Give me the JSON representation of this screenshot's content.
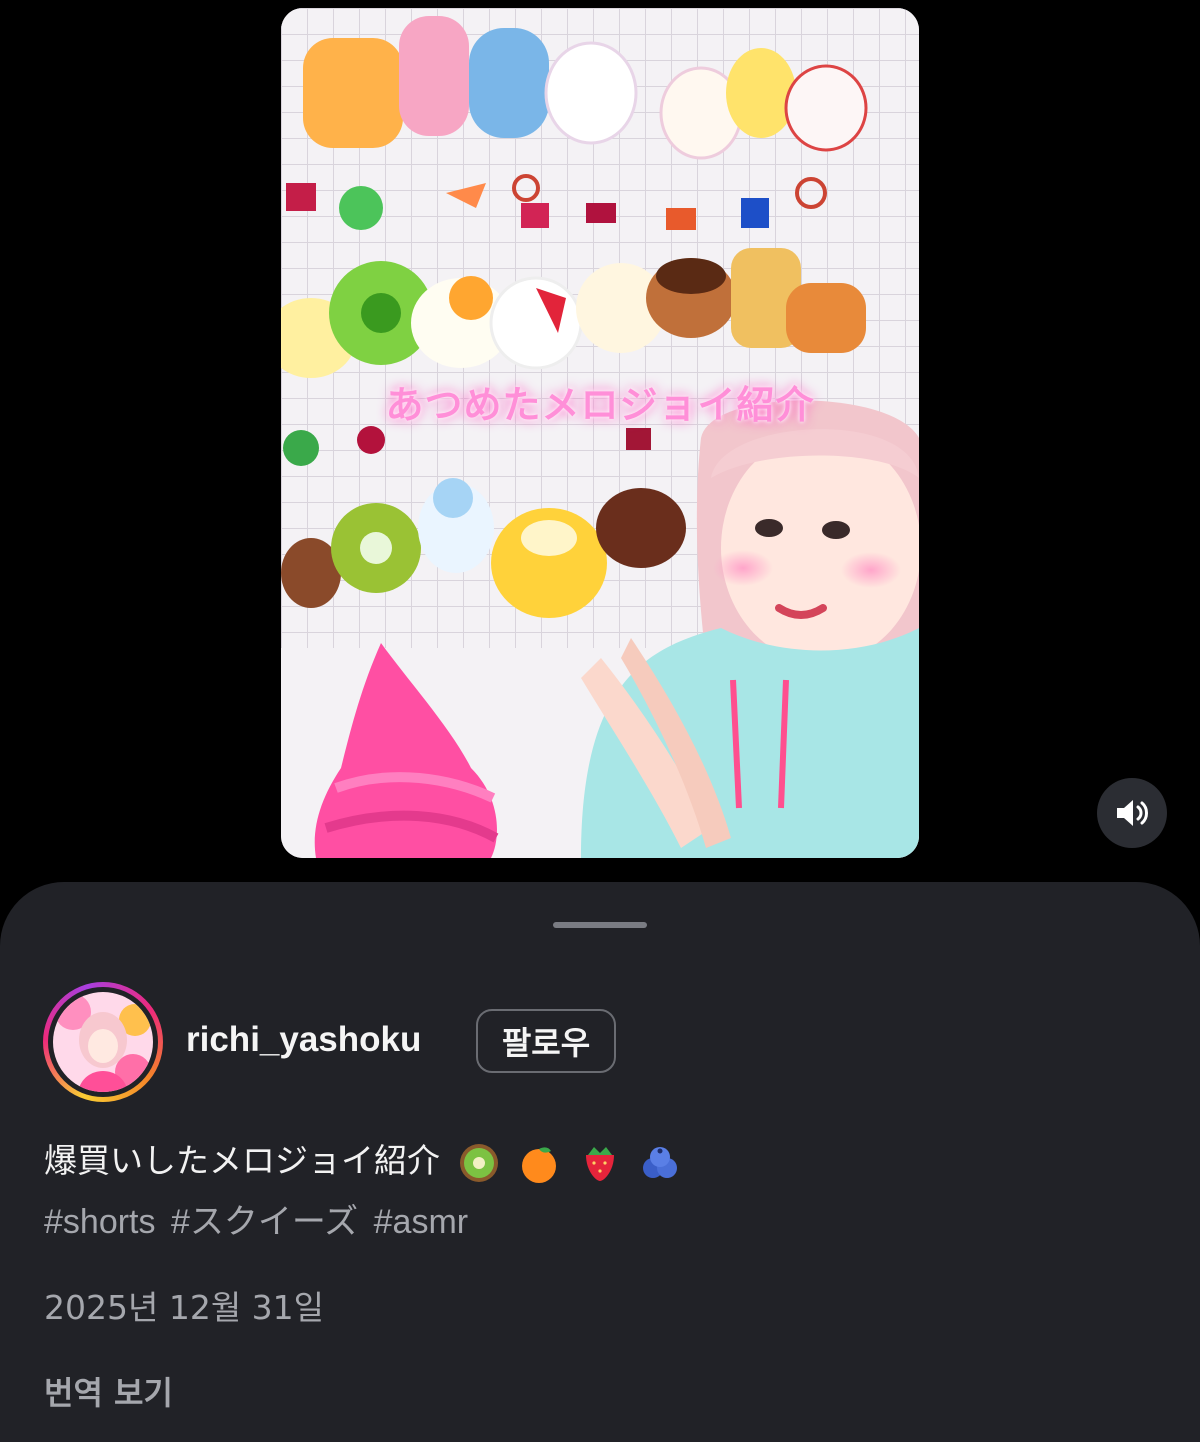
{
  "video": {
    "overlay_caption": "あつめたメロジョイ紹介"
  },
  "controls": {
    "mute_icon": "speaker-icon"
  },
  "sheet": {
    "username": "richi_yashoku",
    "follow_label": "팔로우",
    "caption": "爆買いしたメロジョイ紹介",
    "caption_emojis": [
      "kiwi-emoji",
      "orange-emoji",
      "strawberry-emoji",
      "blueberries-emoji"
    ],
    "hashtags": [
      "#shorts",
      "#スクイーズ",
      "#asmr"
    ],
    "date": "2025년 12월 31일",
    "translate_label": "번역 보기"
  },
  "colors": {
    "sheet_bg": "#212227",
    "muted_text": "#a5a7ad",
    "story_ring": [
      "#f9ce34",
      "#ee2a7b",
      "#a83fe0"
    ]
  }
}
